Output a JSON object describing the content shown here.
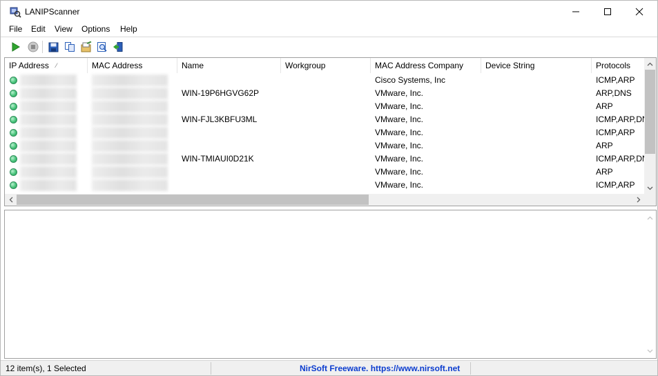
{
  "window": {
    "title": "LANIPScanner"
  },
  "menu": [
    "File",
    "Edit",
    "View",
    "Options",
    "Help"
  ],
  "toolbar": [
    "start-scan",
    "stop-scan",
    "save",
    "copy",
    "properties",
    "html-report",
    "exit"
  ],
  "list": {
    "columns": [
      "IP Address",
      "MAC Address",
      "Name",
      "Workgroup",
      "MAC Address Company",
      "Device String",
      "Protocols"
    ],
    "rows": [
      {
        "name": "",
        "workgroup": "",
        "company": "Cisco Systems, Inc",
        "device": "",
        "protocols": "ICMP,ARP"
      },
      {
        "name": "WIN-19P6HGVG62P",
        "workgroup": "",
        "company": "VMware, Inc.",
        "device": "",
        "protocols": "ARP,DNS"
      },
      {
        "name": "",
        "workgroup": "",
        "company": "VMware, Inc.",
        "device": "",
        "protocols": "ARP"
      },
      {
        "name": "WIN-FJL3KBFU3ML",
        "workgroup": "",
        "company": "VMware, Inc.",
        "device": "",
        "protocols": "ICMP,ARP,DN"
      },
      {
        "name": "",
        "workgroup": "",
        "company": "VMware, Inc.",
        "device": "",
        "protocols": "ICMP,ARP"
      },
      {
        "name": "",
        "workgroup": "",
        "company": "VMware, Inc.",
        "device": "",
        "protocols": "ARP"
      },
      {
        "name": "WIN-TMIAUI0D21K",
        "workgroup": "",
        "company": "VMware, Inc.",
        "device": "",
        "protocols": "ICMP,ARP,DN"
      },
      {
        "name": "",
        "workgroup": "",
        "company": "VMware, Inc.",
        "device": "",
        "protocols": "ARP"
      },
      {
        "name": "",
        "workgroup": "",
        "company": "VMware, Inc.",
        "device": "",
        "protocols": "ICMP,ARP"
      }
    ]
  },
  "status": {
    "count": "12 item(s), 1 Selected",
    "credit": "NirSoft Freeware. https://www.nirsoft.net"
  },
  "colors": {
    "link": "#0b3ccf",
    "status_dot": "#48c47b"
  }
}
